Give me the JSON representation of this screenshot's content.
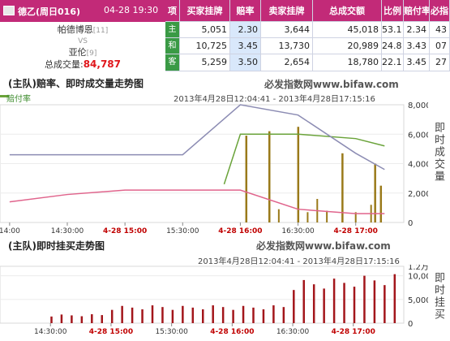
{
  "match": {
    "league": "德乙(周日016)",
    "datetime": "04-28 19:30",
    "home_team": "帕德博恩",
    "home_rank": "[11]",
    "vs": "VS",
    "away_team": "亚伦",
    "away_rank": "[9]",
    "volume_label": "总成交量:",
    "volume_value": "84,787"
  },
  "table": {
    "headers": [
      "项",
      "买家挂牌",
      "赔率",
      "卖家挂牌",
      "总成交额",
      "比例",
      "赔付率",
      "必指"
    ],
    "rows": [
      {
        "label": "主",
        "buy": "5,051",
        "odds": "2.30",
        "sell": "3,644",
        "total": "45,018",
        "ratio": "53.1",
        "payout": "2.34",
        "index": "43"
      },
      {
        "label": "和",
        "buy": "10,725",
        "odds": "3.45",
        "sell": "13,730",
        "total": "20,989",
        "ratio": "24.8",
        "payout": "3.43",
        "index": "07"
      },
      {
        "label": "客",
        "buy": "5,259",
        "odds": "3.50",
        "sell": "2,654",
        "total": "18,780",
        "ratio": "22.1",
        "payout": "3.45",
        "index": "27"
      }
    ]
  },
  "chart1": {
    "title": "(主队)赔率、即时成交量走势图",
    "brand": "必发指数网www.bifaw.com",
    "legend": "赔付率",
    "range": "2013年4月28日12:04:41 - 2013年4月28日17:15:16",
    "axis_title": "即时成交量",
    "y_ticks": [
      "8,000",
      "6,000",
      "4,000",
      "2,000",
      "0"
    ],
    "x_ticks": [
      "14:00",
      "14:30:00",
      "4-28 15:00",
      "15:30:00",
      "4-28 16:00",
      "16:30:00",
      "4-28 17:00"
    ]
  },
  "chart2": {
    "title": "(主队)即时挂买走势图",
    "brand": "必发指数网www.bifaw.com",
    "range": "2013年4月28日12:04:41 - 2013年4月28日17:15:16",
    "axis_title": "即时挂买",
    "y_ticks": [
      "1.2万",
      "10,000",
      "5,000",
      "0"
    ],
    "x_ticks": [
      "14:30:00",
      "4-28 15:00",
      "15:30:00",
      "4-28 16:00",
      "16:30:00",
      "4-28 17:00"
    ]
  },
  "chart_data": [
    {
      "type": "line",
      "title": "(主队)赔率、即时成交量走势图",
      "ylabel": "即时成交量",
      "ylim": [
        0,
        8000
      ],
      "x": [
        "14:00",
        "14:30",
        "15:00",
        "15:30",
        "16:00",
        "16:30",
        "17:00",
        "17:15"
      ],
      "series": [
        {
          "name": "赔付率",
          "color": "#6aa33a",
          "values": [
            null,
            null,
            null,
            null,
            6000,
            6000,
            5700,
            5200
          ]
        },
        {
          "color": "#8c8cb3",
          "values": [
            4600,
            4600,
            4600,
            4600,
            8000,
            7300,
            4700,
            3600
          ]
        },
        {
          "color": "#e0648c",
          "values": [
            1400,
            1900,
            2200,
            2200,
            2200,
            900,
            600,
            600
          ]
        }
      ],
      "bars": {
        "color": "#9a7a1a",
        "peak_times": [
          "16:03",
          "16:15",
          "16:30",
          "16:53",
          "17:10",
          "17:13"
        ],
        "peak_values": [
          5900,
          6200,
          6500,
          4700,
          4000,
          2500
        ]
      }
    },
    {
      "type": "bar",
      "title": "(主队)即时挂买走势图",
      "ylabel": "即时挂买",
      "ylim": [
        0,
        12000
      ],
      "x": [
        "14:30",
        "15:00",
        "15:30",
        "16:00",
        "16:30",
        "17:00"
      ],
      "values": [
        2000,
        4000,
        4000,
        4000,
        10000,
        11000
      ],
      "color": "#a3161b"
    }
  ]
}
